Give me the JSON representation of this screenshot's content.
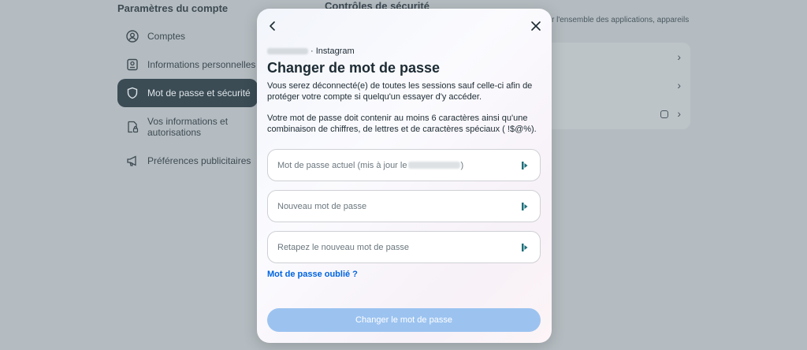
{
  "background": {
    "left_title": "Paramètres du compte",
    "nav": [
      {
        "label": "Comptes",
        "icon": "user-circle-icon"
      },
      {
        "label": "Informations personnelles",
        "icon": "id-card-icon"
      },
      {
        "label": "Mot de passe et sécurité",
        "icon": "shield-icon",
        "active": true
      },
      {
        "label": "Vos informations et autorisations",
        "icon": "document-lock-icon"
      },
      {
        "label": "Préférences publicitaires",
        "icon": "megaphone-icon"
      }
    ],
    "right_title": "Contrôles de sécurité",
    "right_subtitle": "r l'ensemble des applications, appareils"
  },
  "modal": {
    "account_suffix": "· Instagram",
    "title": "Changer de mot de passe",
    "description_1": "Vous serez déconnecté(e) de toutes les sessions sauf celle-ci afin de protéger votre compte si quelqu'un essayer d'y accéder.",
    "description_2": "Votre mot de passe doit contenir au moins 6 caractères ainsi qu'une combinaison de chiffres, de lettres et de caractères spéciaux ( !$@%).",
    "current_password_label": "Mot de passe actuel (mis à jour le",
    "current_password_label_end": ")",
    "new_password_placeholder": "Nouveau mot de passe",
    "retype_password_placeholder": "Retapez le nouveau mot de passe",
    "forgot_link": "Mot de passe oublié ?",
    "submit_label": "Changer le mot de passe"
  },
  "colors": {
    "accent_link": "#0064e0",
    "submit_disabled": "#9cc3f0",
    "backdrop": "#b4bcc1"
  }
}
